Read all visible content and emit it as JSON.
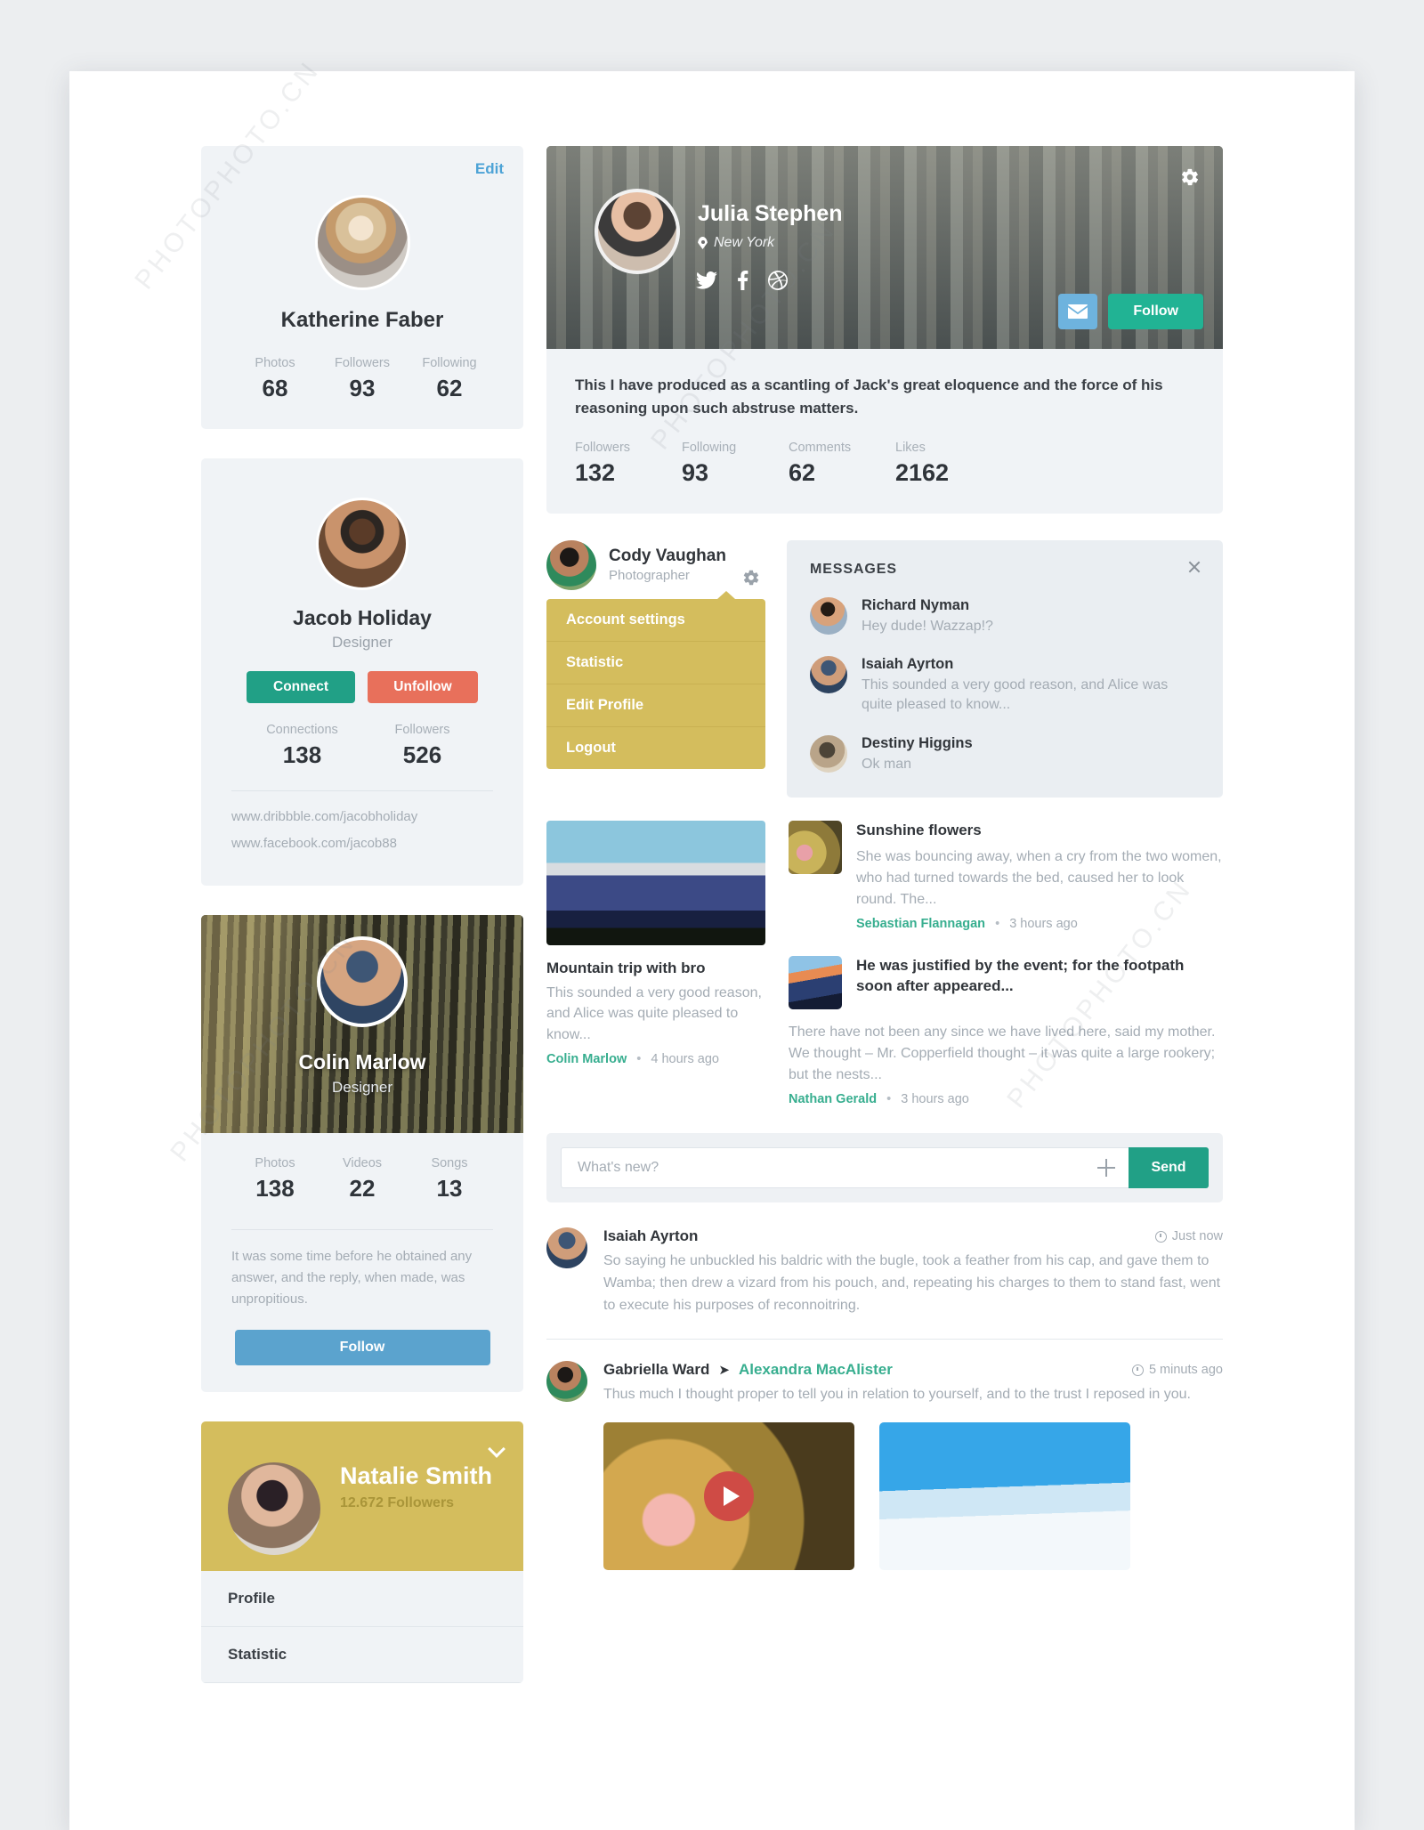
{
  "left_column": {
    "profile_card": {
      "edit_label": "Edit",
      "name": "Katherine Faber",
      "stats": [
        {
          "label": "Photos",
          "value": "68"
        },
        {
          "label": "Followers",
          "value": "93"
        },
        {
          "label": "Following",
          "value": "62"
        }
      ]
    },
    "connect_card": {
      "name": "Jacob Holiday",
      "role": "Designer",
      "connect_label": "Connect",
      "unfollow_label": "Unfollow",
      "stats": [
        {
          "label": "Connections",
          "value": "138"
        },
        {
          "label": "Followers",
          "value": "526"
        }
      ],
      "links": [
        "www.dribbble.com/jacobholiday",
        "www.facebook.com/jacob88"
      ]
    },
    "cover_card": {
      "name": "Colin Marlow",
      "role": "Designer",
      "stats": [
        {
          "label": "Photos",
          "value": "138"
        },
        {
          "label": "Videos",
          "value": "22"
        },
        {
          "label": "Songs",
          "value": "13"
        }
      ],
      "bio": "It was some time before he obtained any answer, and the reply, when made, was unpropitious.",
      "follow_label": "Follow"
    },
    "nav_card": {
      "name": "Natalie Smith",
      "followers": "12.672 Followers",
      "items": [
        {
          "label": "Profile"
        },
        {
          "label": "Statistic"
        }
      ]
    }
  },
  "hero": {
    "name": "Julia Stephen",
    "location": "New York",
    "socials": [
      "twitter-icon",
      "facebook-icon",
      "dribbble-icon"
    ],
    "mail_icon": "envelope-icon",
    "follow_label": "Follow",
    "settings_icon": "gear-icon",
    "bio": "This I have produced as a scantling of Jack's great eloquence and the force of his reasoning upon such abstruse matters.",
    "stats": [
      {
        "label": "Followers",
        "value": "132"
      },
      {
        "label": "Following",
        "value": "93"
      },
      {
        "label": "Comments",
        "value": "62"
      },
      {
        "label": "Likes",
        "value": "2162"
      }
    ]
  },
  "account_menu": {
    "name": "Cody Vaughan",
    "role": "Photographer",
    "settings_icon": "gear-icon",
    "items": [
      {
        "label": "Account settings"
      },
      {
        "label": "Statistic"
      },
      {
        "label": "Edit Profile"
      },
      {
        "label": "Logout"
      }
    ]
  },
  "messages": {
    "title": "MESSAGES",
    "close_icon": "close-icon",
    "items": [
      {
        "name": "Richard Nyman",
        "preview": "Hey dude! Wazzap!?"
      },
      {
        "name": "Isaiah Ayrton",
        "preview": "This sounded a very good reason, and Alice was quite pleased to know..."
      },
      {
        "name": "Destiny Higgins",
        "preview": "Ok man"
      }
    ]
  },
  "featured_post": {
    "title": "Mountain trip with bro",
    "excerpt": "This sounded a very good reason, and Alice was quite pleased to know...",
    "author": "Colin Marlow",
    "time": "4 hours ago",
    "separator": "•"
  },
  "post_list": [
    {
      "title": "Sunshine flowers",
      "excerpt": "She was bouncing away, when a cry from the two women, who had turned towards the bed, caused her to look round. The...",
      "author": "Sebastian Flannagan",
      "time": "3 hours ago",
      "separator": "•"
    },
    {
      "title": "He was justified by the event; for the footpath soon after appeared...",
      "excerpt": "There have not been any since we have lived here, said my mother. We thought – Mr. Copperfield thought – it was quite a large rookery; but the nests...",
      "author": "Nathan Gerald",
      "time": "3 hours ago",
      "separator": "•"
    }
  ],
  "composer": {
    "placeholder": "What's new?",
    "value": "",
    "add_icon": "plus-icon",
    "send_label": "Send"
  },
  "feed": [
    {
      "name": "Isaiah Ayrton",
      "time": "Just now",
      "time_icon": "clock-icon",
      "text": "So saying he unbuckled his baldric with the bugle, took a feather from his cap, and gave them to Wamba; then drew a vizard from his pouch, and, repeating his charges to them to stand fast, went to execute his purposes of reconnoitring."
    },
    {
      "name": "Gabriella Ward",
      "arrow": "➤",
      "target": "Alexandra MacAlister",
      "time": "5 minuts ago",
      "time_icon": "clock-icon",
      "text": "Thus much I thought proper to tell you in relation to yourself, and to the trust I reposed in you.",
      "gallery": [
        {
          "type": "video",
          "play_icon": "play-icon"
        },
        {
          "type": "image"
        }
      ]
    }
  ],
  "colors": {
    "teal": "#21a086",
    "hero_teal": "#21b394",
    "coral": "#e8705b",
    "blue": "#5ba3ce",
    "mail_blue": "#6eb3de",
    "gold": "#d4bd5d",
    "link_blue": "#4da3d6",
    "accent_green": "#37ae8f",
    "card_bg": "#f0f3f6",
    "play_red": "#cf4b45"
  },
  "watermarks": [
    "PHOTOPHOTO.CN",
    "PHOTOPHOTO.CN",
    "PHOTOPHOTO.CN",
    "PHOTOPHOTO.CN"
  ]
}
